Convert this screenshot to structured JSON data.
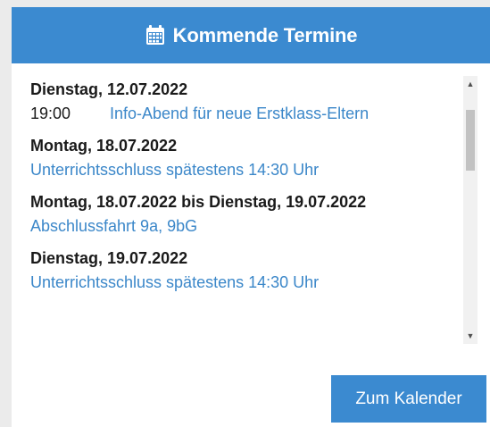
{
  "header": {
    "icon": "calendar-icon",
    "title": "Kommende Termine"
  },
  "events": [
    {
      "date": "Dienstag, 12.07.2022",
      "time": "19:00",
      "title": "Info-Abend für neue Erstklass-Eltern"
    },
    {
      "date": "Montag, 18.07.2022",
      "time": "",
      "title": "Unterrichtsschluss spätestens 14:30 Uhr"
    },
    {
      "date": "Montag, 18.07.2022 bis Dienstag, 19.07.2022",
      "time": "",
      "title": "Abschlussfahrt 9a, 9bG"
    },
    {
      "date": "Dienstag, 19.07.2022",
      "time": "",
      "title": "Unterrichtsschluss spätestens 14:30 Uhr"
    }
  ],
  "button": {
    "label": "Zum Kalender"
  },
  "colors": {
    "accent": "#3b8ad0",
    "link": "#3b87c9",
    "background": "#ebebeb"
  }
}
